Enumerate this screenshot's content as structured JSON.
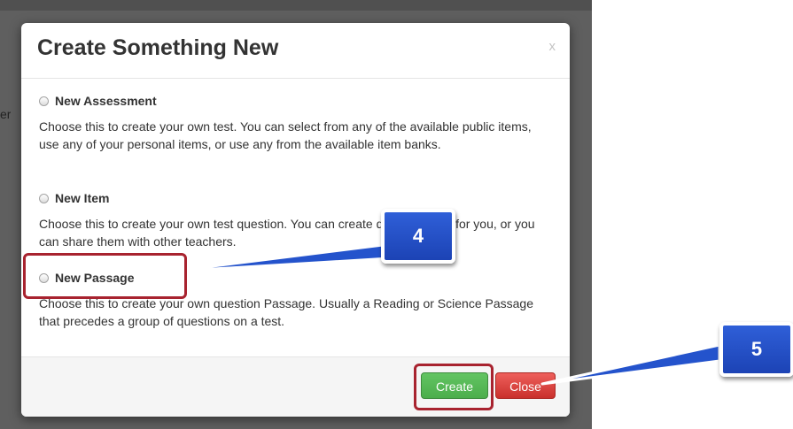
{
  "background_fragment": "er",
  "modal": {
    "title": "Create Something New",
    "close_glyph": "x",
    "options": [
      {
        "label": "New Assessment",
        "description": "Choose this to create your own test. You can select from any of the available public items, use any of your personal items, or use any from the available item banks."
      },
      {
        "label": "New Item",
        "description": "Choose this to create your own test question. You can create questions just for you, or you can share them with other teachers."
      },
      {
        "label": "New Passage",
        "description": "Choose this to create your own question Passage. Usually a Reading or Science Passage that precedes a group of questions on a test."
      }
    ],
    "footer": {
      "create_label": "Create",
      "close_label": "Close"
    }
  },
  "callouts": [
    {
      "number": "4"
    },
    {
      "number": "5"
    }
  ],
  "colors": {
    "callout_blue": "#2453cc",
    "highlight_red": "#a8232f",
    "create_green": "#5cb85c",
    "close_red": "#d9534f"
  }
}
